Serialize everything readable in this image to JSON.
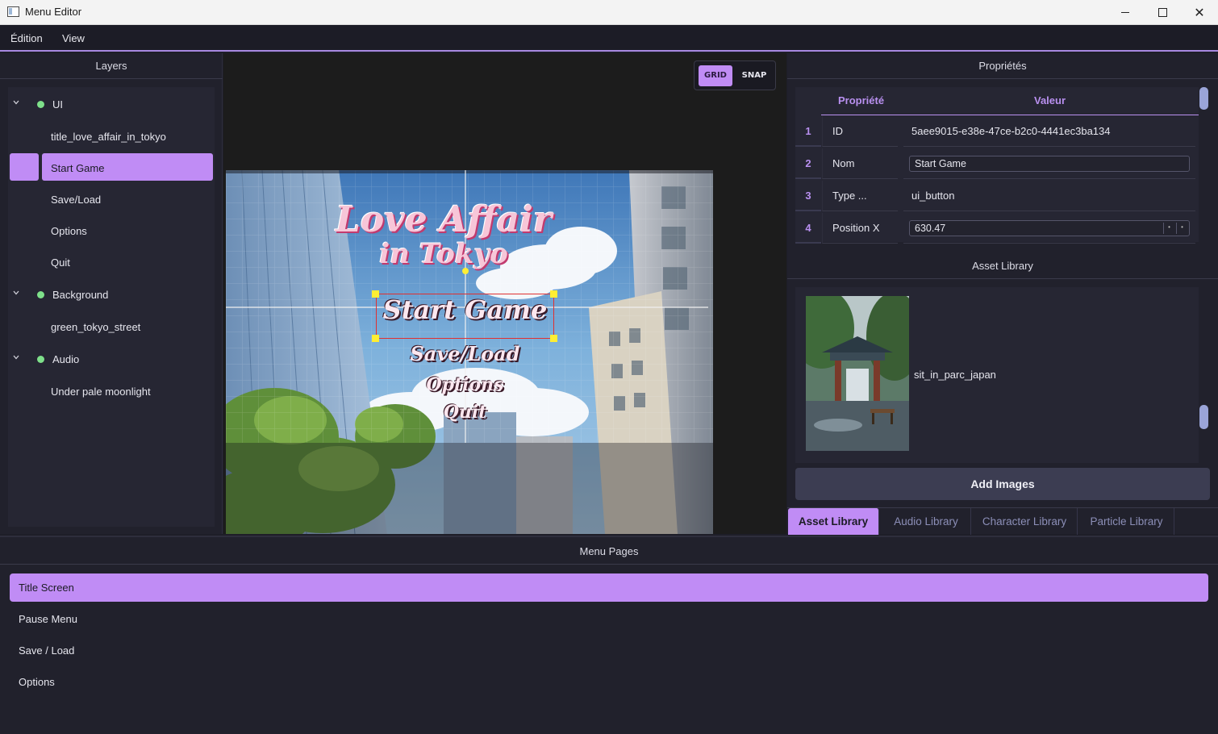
{
  "window": {
    "title": "Menu Editor"
  },
  "menubar": {
    "items": [
      "Édition",
      "View"
    ]
  },
  "layers": {
    "header": "Layers",
    "items": [
      {
        "label": "UI",
        "type": "group"
      },
      {
        "label": "title_love_affair_in_tokyo",
        "type": "item"
      },
      {
        "label": "Start Game",
        "type": "item",
        "selected": true
      },
      {
        "label": "Save/Load",
        "type": "item"
      },
      {
        "label": "Options",
        "type": "item"
      },
      {
        "label": "Quit",
        "type": "item"
      },
      {
        "label": "Background",
        "type": "group"
      },
      {
        "label": "green_tokyo_street",
        "type": "item"
      },
      {
        "label": "Audio",
        "type": "group"
      },
      {
        "label": "Under pale moonlight",
        "type": "item"
      }
    ]
  },
  "canvas": {
    "grid_label": "GRID",
    "snap_label": "SNAP",
    "grid_on": true,
    "scene": {
      "title_line1": "Love Affair",
      "title_line2": "in Tokyo",
      "buttons": [
        "Start Game",
        "Save/Load",
        "Options",
        "Quit"
      ]
    }
  },
  "properties": {
    "header": "Propriétés",
    "col_property": "Propriété",
    "col_value": "Valeur",
    "rows": [
      {
        "num": "1",
        "key": "ID",
        "value": "5aee9015-e38e-47ce-b2c0-4441ec3ba134"
      },
      {
        "num": "2",
        "key": "Nom",
        "value": "Start Game"
      },
      {
        "num": "3",
        "key": "Type ...",
        "value": "ui_button"
      },
      {
        "num": "4",
        "key": "Position X",
        "value": "630.47"
      }
    ]
  },
  "asset_library": {
    "header": "Asset Library",
    "asset_name": "sit_in_parc_japan",
    "add_button": "Add Images",
    "tabs": [
      "Asset Library",
      "Audio Library",
      "Character Library",
      "Particle Library"
    ],
    "active_tab": "Asset Library"
  },
  "menu_pages": {
    "header": "Menu Pages",
    "items": [
      "Title Screen",
      "Pause Menu",
      "Save / Load",
      "Options"
    ],
    "active": "Title Screen"
  },
  "colors": {
    "accent": "#c08cf5",
    "bg": "#1e1e28",
    "panel": "#21212c",
    "layer_dot": "#7ee08a"
  }
}
